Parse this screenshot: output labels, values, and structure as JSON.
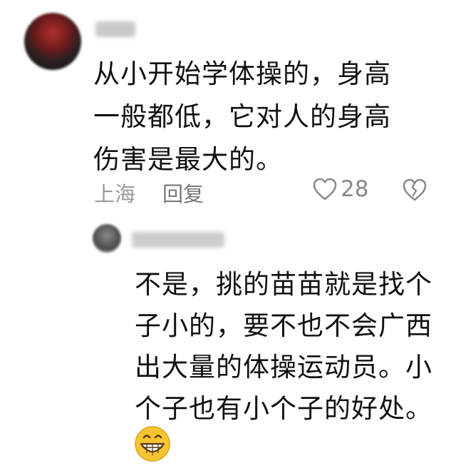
{
  "main_comment": {
    "text": "从小开始学体操的，身高一般都低，它对人的身高伤害是最大的。",
    "location": "上海",
    "reply_label": "回复",
    "like_count": "28",
    "icons": {
      "like": "heart-icon",
      "dislike": "broken-heart-icon"
    }
  },
  "reply_comment": {
    "text": "不是，挑的苗苗就是找个子小的，要不也不会广西出大量的体操运动员。小个子也有小个子的好处。",
    "emoji": "grinning-face-emoji"
  }
}
